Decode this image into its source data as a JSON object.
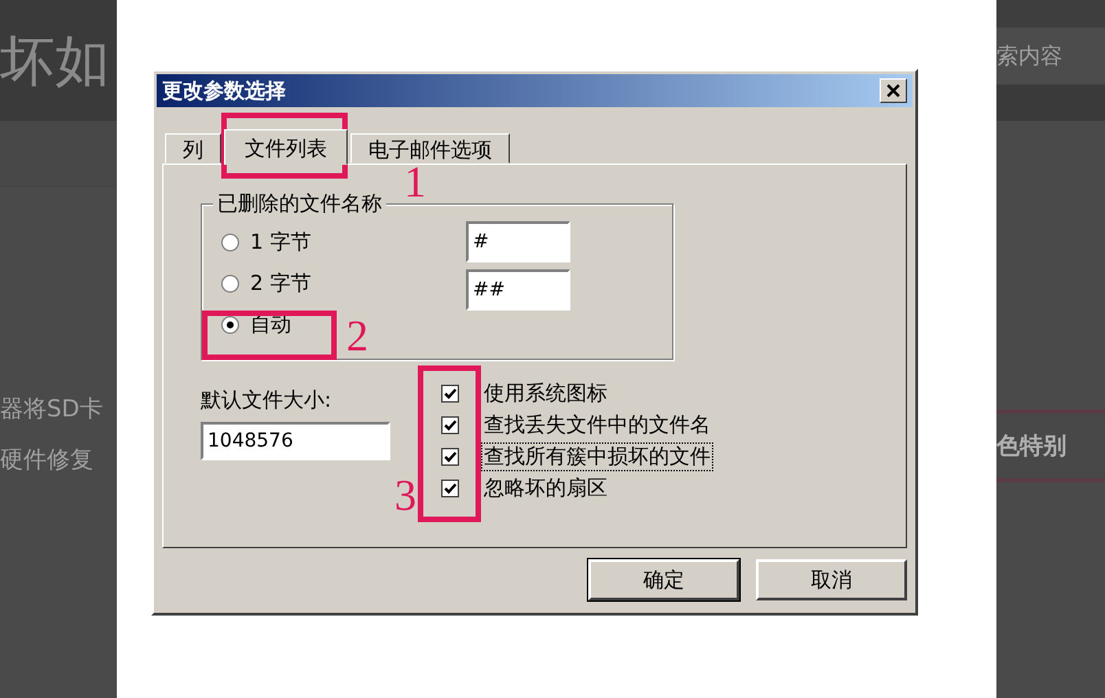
{
  "background_page": {
    "title": "坏如",
    "search": {
      "placeholder": "索内容"
    },
    "lines": [
      "器将SD卡",
      "硬件修复"
    ],
    "highlight": "色特别"
  },
  "dialog": {
    "title": "更改参数选择",
    "tabs": [
      {
        "label": "列",
        "selected": false
      },
      {
        "label": "文件列表",
        "selected": true
      },
      {
        "label": "电子邮件选项",
        "selected": false
      }
    ],
    "group": {
      "title": "已删除的文件名称",
      "options": [
        {
          "label": "1 字节",
          "selected": false
        },
        {
          "label": "2 字节",
          "selected": false
        },
        {
          "label": "自动",
          "selected": true
        }
      ],
      "fields": [
        {
          "value": "#"
        },
        {
          "value": "##"
        }
      ]
    },
    "size": {
      "label": "默认文件大小:",
      "value": "1048576"
    },
    "checkboxes": [
      {
        "label": "使用系统图标",
        "checked": true,
        "focused": false
      },
      {
        "label": "查找丢失文件中的文件名",
        "checked": true,
        "focused": false
      },
      {
        "label": "查找所有簇中损坏的文件",
        "checked": true,
        "focused": true
      },
      {
        "label": "忽略坏的扇区",
        "checked": true,
        "focused": false
      }
    ],
    "buttons": [
      "确定",
      "取消"
    ]
  },
  "annotations": [
    {
      "number": "1"
    },
    {
      "number": "2"
    },
    {
      "number": "3"
    }
  ]
}
